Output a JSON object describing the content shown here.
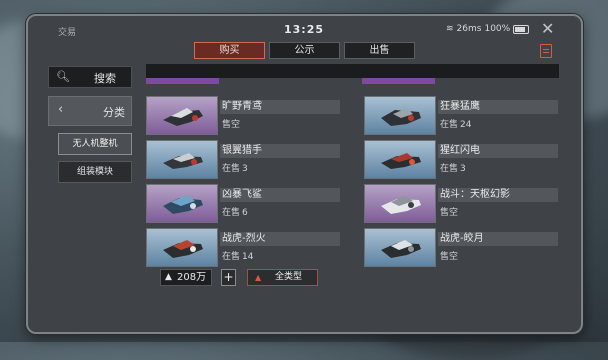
{
  "status": {
    "app_label": "交易",
    "time": "13:25",
    "network": "26ms",
    "battery": "100%"
  },
  "tabs": [
    {
      "label": "购买",
      "active": true
    },
    {
      "label": "公示",
      "active": false
    },
    {
      "label": "出售",
      "active": false
    }
  ],
  "sidebar": {
    "search_label": "搜索",
    "category_label": "分类",
    "items": [
      {
        "label": "无人机整机",
        "active": true
      },
      {
        "label": "组装模块",
        "active": false
      }
    ]
  },
  "items": [
    {
      "name": "旷野青鸢",
      "stock_label": "售空",
      "stock_value": "",
      "thumb": "purple"
    },
    {
      "name": "狂暴猛鹰",
      "stock_label": "在售",
      "stock_value": "24",
      "thumb": "blue"
    },
    {
      "name": "银翼猎手",
      "stock_label": "在售",
      "stock_value": "3",
      "thumb": "blue"
    },
    {
      "name": "猩红闪电",
      "stock_label": "在售",
      "stock_value": "3",
      "thumb": "blue"
    },
    {
      "name": "凶暴飞鲨",
      "stock_label": "在售",
      "stock_value": "6",
      "thumb": "purple"
    },
    {
      "name": "战斗：天枢幻影",
      "stock_label": "售空",
      "stock_value": "",
      "thumb": "purple"
    },
    {
      "name": "战虎-烈火",
      "stock_label": "在售",
      "stock_value": "14",
      "thumb": "blue"
    },
    {
      "name": "战虎-皎月",
      "stock_label": "售空",
      "stock_value": "",
      "thumb": "blue"
    }
  ],
  "footer": {
    "currency_value": "208万",
    "plus_label": "+",
    "filter_label": "全类型"
  },
  "colors": {
    "accent": "#d9583f",
    "tab_active_bg": "#6a2b22",
    "thumb_purple": "#7e5d99",
    "thumb_blue": "#5e83a2"
  },
  "icons": {
    "search": "search-icon",
    "back": "chevron-left-icon",
    "close": "close-icon",
    "doc": "document-icon",
    "currency": "currency-icon",
    "filter": "filter-icon",
    "wifi": "wifi-icon",
    "battery": "battery-icon"
  }
}
